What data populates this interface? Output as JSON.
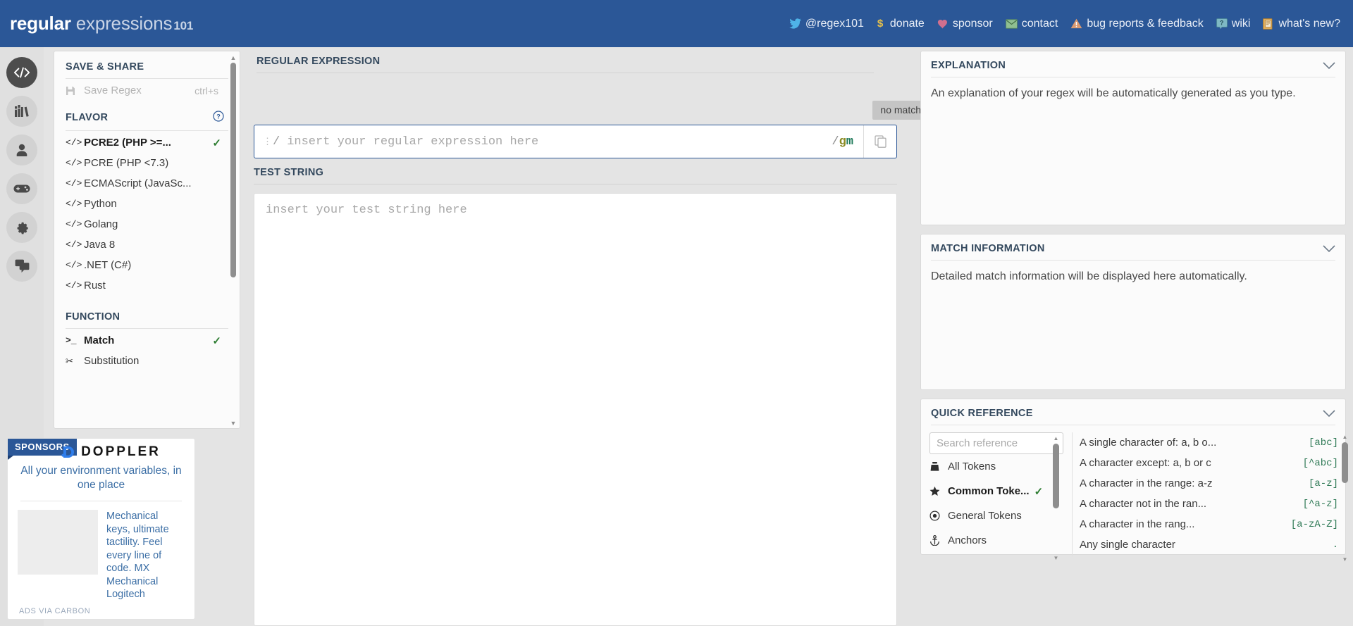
{
  "header": {
    "logo_bold": "regular",
    "logo_light": "expressions",
    "logo_num": "101",
    "nav": [
      {
        "icon": "twitter-icon",
        "label": "@regex101"
      },
      {
        "icon": "dollar-icon",
        "label": "donate"
      },
      {
        "icon": "heart-icon",
        "label": "sponsor"
      },
      {
        "icon": "mail-icon",
        "label": "contact"
      },
      {
        "icon": "warning-icon",
        "label": "bug reports & feedback"
      },
      {
        "icon": "question-box-icon",
        "label": "wiki"
      },
      {
        "icon": "news-icon",
        "label": "what's new?"
      }
    ]
  },
  "rail": [
    {
      "icon": "code-icon",
      "name": "regex-editor",
      "active": true
    },
    {
      "icon": "library-icon",
      "name": "library",
      "active": false
    },
    {
      "icon": "account-icon",
      "name": "account",
      "active": false
    },
    {
      "icon": "gamepad-icon",
      "name": "regex-quiz",
      "active": false
    },
    {
      "icon": "gear-icon",
      "name": "settings",
      "active": false
    },
    {
      "icon": "chat-icon",
      "name": "live-help",
      "active": false
    }
  ],
  "left_panel": {
    "save_share": {
      "title": "SAVE & SHARE",
      "save_label": "Save Regex",
      "save_shortcut": "ctrl+s",
      "save_icon": "floppy-icon"
    },
    "flavor": {
      "title": "FLAVOR",
      "help_icon": "question-circle-icon",
      "items": [
        {
          "label": "PCRE2 (PHP >=...",
          "selected": true
        },
        {
          "label": "PCRE (PHP <7.3)",
          "selected": false
        },
        {
          "label": "ECMAScript (JavaSc...",
          "selected": false
        },
        {
          "label": "Python",
          "selected": false
        },
        {
          "label": "Golang",
          "selected": false
        },
        {
          "label": "Java 8",
          "selected": false
        },
        {
          "label": ".NET (C#)",
          "selected": false
        },
        {
          "label": "Rust",
          "selected": false
        }
      ]
    },
    "function": {
      "title": "FUNCTION",
      "items": [
        {
          "label": "Match",
          "icon": "prompt-icon",
          "selected": true
        },
        {
          "label": "Substitution",
          "icon": "scissors-icon",
          "selected": false
        }
      ]
    }
  },
  "sponsor": {
    "tag": "SPONSORS",
    "brand": "DOPPLER",
    "tagline": "All your environment variables, in one place",
    "ad_text": "Mechanical keys, ultimate tactility. Feel every line of code. MX Mechanical Logitech",
    "ads_via": "ADS VIA CARBON"
  },
  "center": {
    "regex_label": "REGULAR EXPRESSION",
    "match_status": "no match",
    "regex_slash": "/",
    "regex_placeholder": "insert your regular expression here",
    "flags_slash": "/",
    "flag_g": "g",
    "flag_m": "m",
    "copy_icon": "copy-icon",
    "test_label": "TEST STRING",
    "test_placeholder": "insert your test string here"
  },
  "right": {
    "explanation": {
      "title": "EXPLANATION",
      "body": "An explanation of your regex will be automatically generated as you type.",
      "chevron": "chevron-down-icon"
    },
    "match_information": {
      "title": "MATCH INFORMATION",
      "body": "Detailed match information will be displayed here automatically.",
      "chevron": "chevron-down-icon"
    },
    "quick_reference": {
      "title": "QUICK REFERENCE",
      "chevron": "chevron-down-icon",
      "search_placeholder": "Search reference",
      "categories": [
        {
          "label": "All Tokens",
          "icon": "tokens-icon",
          "selected": false
        },
        {
          "label": "Common Toke...",
          "icon": "star-icon",
          "selected": true
        },
        {
          "label": "General Tokens",
          "icon": "target-icon",
          "selected": false
        },
        {
          "label": "Anchors",
          "icon": "anchor-icon",
          "selected": false
        }
      ],
      "items": [
        {
          "desc": "A single character of: a, b o...",
          "token": "[abc]"
        },
        {
          "desc": "A character except: a, b or c",
          "token": "[^abc]"
        },
        {
          "desc": "A character in the range: a-z",
          "token": "[a-z]"
        },
        {
          "desc": "A character not in the ran...",
          "token": "[^a-z]"
        },
        {
          "desc": "A character in the rang...",
          "token": "[a-zA-Z]"
        },
        {
          "desc": "Any single character",
          "token": "."
        }
      ]
    }
  },
  "colors": {
    "header_blue": "#2b5797",
    "page_bg": "#e4e4e4",
    "panel_bg": "#fbfbfb",
    "accent_green": "#2e7d32",
    "token_green": "#2f7a56",
    "link_blue": "#3b6ea5"
  }
}
